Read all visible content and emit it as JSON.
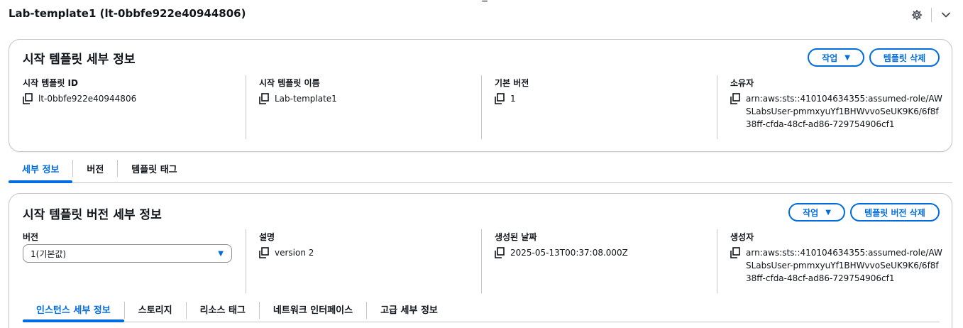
{
  "header": {
    "title": "Lab-template1 (lt-0bbfe922e40944806)",
    "drag_handle": "="
  },
  "template_details": {
    "title": "시작 템플릿 세부 정보",
    "actions_label": "작업",
    "delete_label": "템플릿 삭제",
    "fields": [
      {
        "label": "시작 템플릿 ID",
        "value": "lt-0bbfe922e40944806"
      },
      {
        "label": "시작 템플릿 이름",
        "value": "Lab-template1"
      },
      {
        "label": "기본 버전",
        "value": "1"
      },
      {
        "label": "소유자",
        "value": "arn:aws:sts::410104634355:assumed-role/AWSLabsUser-pmmxyuYf1BHWvvoSeUK9K6/6f8f38ff-cfda-48cf-ad86-729754906cf1"
      }
    ]
  },
  "main_tabs": [
    "세부 정보",
    "버전",
    "템플릿 태그"
  ],
  "version_details": {
    "title": "시작 템플릿 버전 세부 정보",
    "actions_label": "작업",
    "delete_label": "템플릿 버전 삭제",
    "version_label": "버전",
    "version_selected": "1(기본값)",
    "fields": [
      {
        "label": "설명",
        "value": "version 2"
      },
      {
        "label": "생성된 날짜",
        "value": "2025-05-13T00:37:08.000Z"
      },
      {
        "label": "생성자",
        "value": "arn:aws:sts::410104634355:assumed-role/AWSLabsUser-pmmxyuYf1BHWvvoSeUK9K6/6f8f38ff-cfda-48cf-ad86-729754906cf1"
      }
    ],
    "sub_tabs": [
      "인스턴스 세부 정보",
      "스토리지",
      "리소스 태그",
      "네트워크 인터페이스",
      "고급 세부 정보"
    ]
  },
  "colors": {
    "accent": "#006ce0",
    "border": "#c6c6cd",
    "text": "#0f141a"
  },
  "icons": [
    "settings-gear-icon",
    "chevron-down-icon",
    "copy-icon",
    "caret-down-icon"
  ]
}
